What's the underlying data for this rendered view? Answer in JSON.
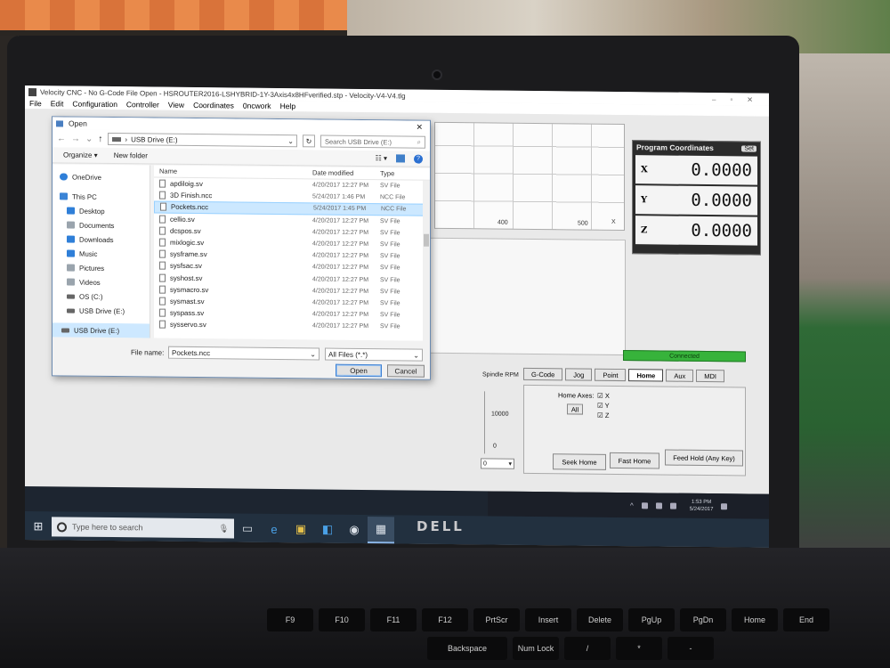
{
  "window": {
    "title": "Velocity CNC - No G-Code File Open - HSROUTER2016-LSHYBRID-1Y-3Axis4x8HFverified.stp - Velocity-V4-V4.tlg",
    "minimize": "–",
    "maximize": "▫",
    "close": "✕"
  },
  "menu": [
    "File",
    "Edit",
    "Configuration",
    "Controller",
    "View",
    "Coordinates",
    "0ncwork",
    "Help"
  ],
  "preview": {
    "x_ticks": [
      "400",
      "500"
    ],
    "axis_label": "X"
  },
  "coordinates": {
    "title": "Program Coordinates",
    "set_label": "Set",
    "rows": [
      {
        "axis": "X",
        "value": "0.0000"
      },
      {
        "axis": "Y",
        "value": "0.0000"
      },
      {
        "axis": "Z",
        "value": "0.0000"
      }
    ]
  },
  "status": {
    "connected": "Connected"
  },
  "tabs": [
    "G-Code",
    "Jog",
    "Point",
    "Home",
    "Aux",
    "MDI"
  ],
  "active_tab": "Home",
  "spindle": {
    "label": "Spindle RPM",
    "value": "10000",
    "zero": "0",
    "select": "0"
  },
  "home": {
    "axes_label": "Home Axes:",
    "all_button": "All",
    "axes": [
      {
        "label": "X",
        "checked": true
      },
      {
        "label": "Y",
        "checked": true
      },
      {
        "label": "Z",
        "checked": true
      }
    ],
    "seek_home": "Seek Home",
    "fast_home": "Fast Home",
    "feed_hold": "Feed Hold (Any Key)"
  },
  "dialog": {
    "title": "Open",
    "close": "✕",
    "path_drive": "USB Drive (E:)",
    "search_placeholder": "Search USB Drive (E:)",
    "organize": "Organize ▾",
    "new_folder": "New folder",
    "nav_items": [
      {
        "label": "OneDrive",
        "color": "#2f7fd8"
      },
      {
        "label": "This PC",
        "color": "#3b84d6"
      },
      {
        "label": "Desktop",
        "color": "#2f7fd8"
      },
      {
        "label": "Documents",
        "color": "#9aa4ad"
      },
      {
        "label": "Downloads",
        "color": "#2f7fd8"
      },
      {
        "label": "Music",
        "color": "#2f7fd8"
      },
      {
        "label": "Pictures",
        "color": "#9aa4ad"
      },
      {
        "label": "Videos",
        "color": "#9aa4ad"
      },
      {
        "label": "OS (C:)",
        "color": "#666666"
      },
      {
        "label": "USB Drive (E:)",
        "color": "#666666"
      },
      {
        "label": "USB Drive (E:)",
        "color": "#666666"
      }
    ],
    "selected_nav_index": 10,
    "columns": {
      "name": "Name",
      "date": "Date modified",
      "type": "Type"
    },
    "files": [
      {
        "name": "apdiloig.sv",
        "date": "4/20/2017 12:27 PM",
        "type": "SV File"
      },
      {
        "name": "3D Finish.ncc",
        "date": "5/24/2017 1:46 PM",
        "type": "NCC File"
      },
      {
        "name": "Pockets.ncc",
        "date": "5/24/2017 1:45 PM",
        "type": "NCC File"
      },
      {
        "name": "cellio.sv",
        "date": "4/20/2017 12:27 PM",
        "type": "SV File"
      },
      {
        "name": "dcspos.sv",
        "date": "4/20/2017 12:27 PM",
        "type": "SV File"
      },
      {
        "name": "mixlogic.sv",
        "date": "4/20/2017 12:27 PM",
        "type": "SV File"
      },
      {
        "name": "sysframe.sv",
        "date": "4/20/2017 12:27 PM",
        "type": "SV File"
      },
      {
        "name": "sysfsac.sv",
        "date": "4/20/2017 12:27 PM",
        "type": "SV File"
      },
      {
        "name": "syshost.sv",
        "date": "4/20/2017 12:27 PM",
        "type": "SV File"
      },
      {
        "name": "sysmacro.sv",
        "date": "4/20/2017 12:27 PM",
        "type": "SV File"
      },
      {
        "name": "sysmast.sv",
        "date": "4/20/2017 12:27 PM",
        "type": "SV File"
      },
      {
        "name": "syspass.sv",
        "date": "4/20/2017 12:27 PM",
        "type": "SV File"
      },
      {
        "name": "sysservo.sv",
        "date": "4/20/2017 12:27 PM",
        "type": "SV File"
      }
    ],
    "selected_file_index": 2,
    "file_name_label": "File name:",
    "file_name_value": "Pockets.ncc",
    "filter": "All Files (*.*)",
    "open_button": "Open",
    "cancel_button": "Cancel"
  },
  "taskbar": {
    "search_placeholder": "Type here to search",
    "time": "1:53 PM",
    "date": "5/24/2017",
    "apps": [
      "mic-icon",
      "task-view-icon",
      "edge-icon",
      "explorer-icon",
      "store-icon",
      "app-icon",
      "cnc-icon"
    ]
  },
  "laptop": {
    "brand": "DELL",
    "keys_row1": [
      "F9",
      "F10",
      "F11",
      "F12",
      "PrtScr",
      "Insert",
      "Delete",
      "PgUp",
      "PgDn",
      "Home",
      "End"
    ],
    "keys_row2": [
      "Backspace",
      "Num Lock",
      "/",
      "*",
      "-"
    ]
  }
}
